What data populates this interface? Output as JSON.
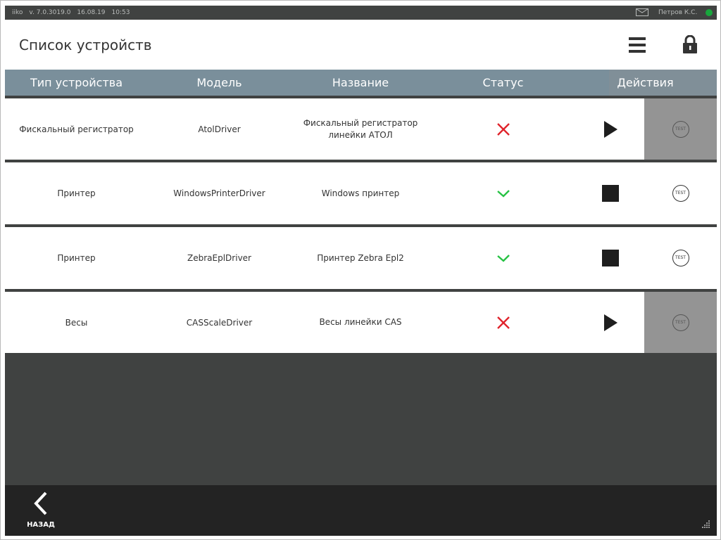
{
  "statusbar": {
    "brand": "iiko",
    "version": "v. 7.0.3019.0",
    "date": "16.08.19",
    "time": "10:53",
    "user": "Петров К.С.",
    "status_color": "#18a63c"
  },
  "header": {
    "title": "Список устройств",
    "icons": [
      "menu-icon",
      "lock-icon"
    ]
  },
  "table": {
    "columns": [
      "Тип устройства",
      "Модель",
      "Название",
      "Статус",
      "Действия"
    ],
    "rows": [
      {
        "type": "Фискальный регистратор",
        "model": "AtolDriver",
        "name_line1": "Фискальный регистратор",
        "name_line2": "линейки АТОЛ",
        "status": "error",
        "action": "play",
        "test_enabled": false,
        "test_label": "TEST"
      },
      {
        "type": "Принтер",
        "model": "WindowsPrinterDriver",
        "name_line1": "Windows принтер",
        "name_line2": "",
        "status": "ok",
        "action": "stop",
        "test_enabled": true,
        "test_label": "TEST"
      },
      {
        "type": "Принтер",
        "model": "ZebraEplDriver",
        "name_line1": "Принтер Zebra Epl2",
        "name_line2": "",
        "status": "ok",
        "action": "stop",
        "test_enabled": true,
        "test_label": "TEST"
      },
      {
        "type": "Весы",
        "model": "CASScaleDriver",
        "name_line1": "Весы линейки CAS",
        "name_line2": "",
        "status": "error",
        "action": "play",
        "test_enabled": false,
        "test_label": "TEST"
      }
    ]
  },
  "colors": {
    "status_ok": "#27c244",
    "status_error": "#e0242c",
    "header_bg": "#7a8f9b",
    "disabled_bg": "#949494"
  },
  "footer": {
    "back_label": "НАЗАД"
  }
}
